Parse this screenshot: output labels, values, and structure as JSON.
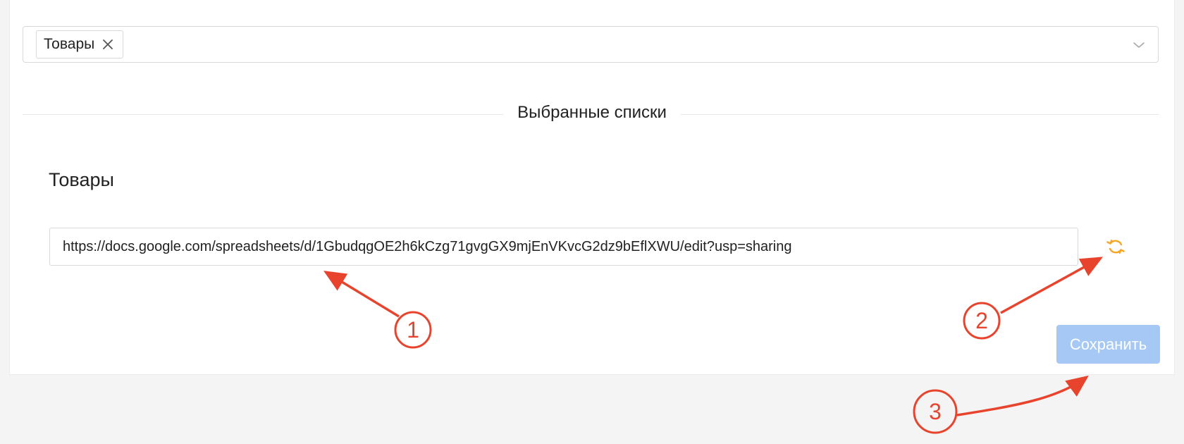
{
  "filter": {
    "selected_tags": [
      {
        "label": "Товары"
      }
    ]
  },
  "divider": {
    "label": "Выбранные списки"
  },
  "list_section": {
    "title": "Товары",
    "url_value": "https://docs.google.com/spreadsheets/d/1GbudqgOE2h6kCzg71gvgGX9mjEnVKvcG2dz9bEflXWU/edit?usp=sharing"
  },
  "actions": {
    "save_label": "Сохранить"
  },
  "annotations": {
    "color": "#e8432c",
    "markers": [
      "1",
      "2",
      "3"
    ]
  },
  "colors": {
    "refresh_icon": "#f5a623",
    "save_button": "#a6c8f4"
  },
  "icons": [
    "close-icon",
    "chevron-down-icon",
    "refresh-icon"
  ]
}
